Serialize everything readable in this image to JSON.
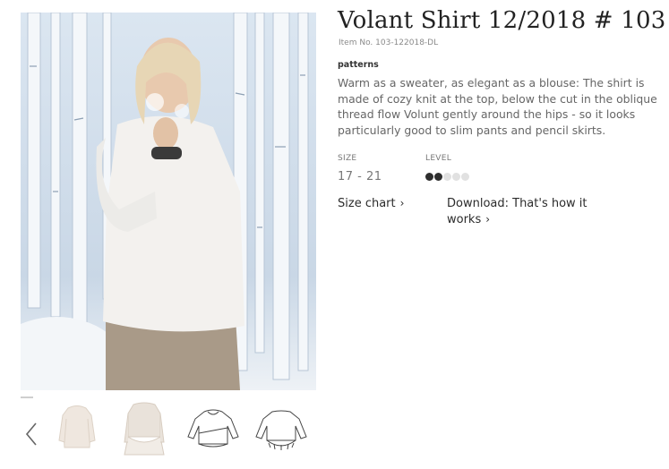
{
  "product": {
    "title": "Volant Shirt 12/2018 # 103",
    "item_no": "Item No. 103-122018-DL",
    "category": "patterns",
    "description": "Warm as a sweater, as elegant as a blouse: The shirt is made of cozy knit at the top, below the cut in the oblique thread flow Volunt gently around the hips - so it looks particularly good to slim pants and pencil skirts."
  },
  "specs": {
    "size_label": "SIZE",
    "size_value": "17 - 21",
    "level_label": "LEVEL",
    "level": 2,
    "level_max": 5
  },
  "links": {
    "size_chart": "Size chart",
    "download": "Download: That's how it works"
  },
  "icons": {
    "prev": "chevron-left-icon",
    "link_arrow": "chevron-right-icon"
  },
  "colors": {
    "level_filled": "#2e2e2e",
    "level_empty": "#e1e1e1"
  }
}
